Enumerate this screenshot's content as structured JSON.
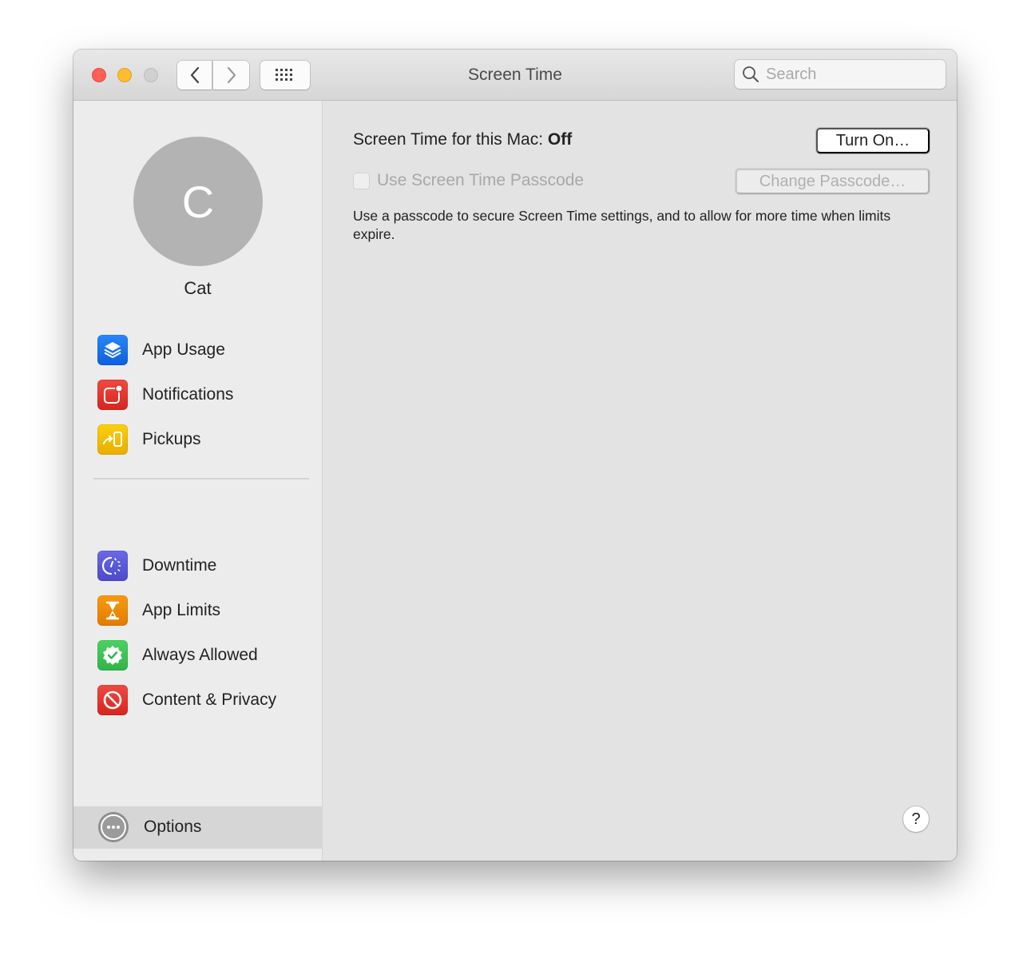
{
  "window": {
    "title": "Screen Time",
    "traffic_lights": {
      "close_color": "#fe5f57",
      "minimize_color": "#febc2e",
      "zoom_color": "#d0d0d0"
    },
    "toolbar": {
      "back_icon": "chevron-left-icon",
      "forward_icon": "chevron-right-icon",
      "grid_icon": "show-all-grid-icon"
    },
    "search": {
      "placeholder": "Search",
      "value": ""
    }
  },
  "sidebar": {
    "user": {
      "initial": "C",
      "name": "Cat",
      "avatar_color": "#b3b3b3"
    },
    "groups": [
      [
        {
          "label": "App Usage",
          "icon": "layers-icon",
          "color": "#1a6ff0"
        },
        {
          "label": "Notifications",
          "icon": "notification-badge-icon",
          "color": "#e5302b"
        },
        {
          "label": "Pickups",
          "icon": "pickup-phone-icon",
          "color": "#f5bd00"
        }
      ],
      [
        {
          "label": "Downtime",
          "icon": "downtime-clock-icon",
          "color": "#5856d6"
        },
        {
          "label": "App Limits",
          "icon": "hourglass-icon",
          "color": "#f28a00"
        },
        {
          "label": "Always Allowed",
          "icon": "checkmark-seal-icon",
          "color": "#3cc552"
        },
        {
          "label": "Content & Privacy",
          "icon": "prohibited-icon",
          "color": "#e5302b"
        }
      ]
    ],
    "options": {
      "label": "Options",
      "icon": "ellipsis-circle-icon",
      "selected": true
    }
  },
  "content": {
    "status_prefix": "Screen Time for this Mac:",
    "status_value": "Off",
    "turn_on_button": "Turn On…",
    "passcode_checkbox": {
      "label": "Use Screen Time Passcode",
      "checked": false,
      "enabled": false
    },
    "change_passcode_button": "Change Passcode…",
    "description": "Use a passcode to secure Screen Time settings, and to allow for more time when limits expire.",
    "help_label": "?"
  }
}
